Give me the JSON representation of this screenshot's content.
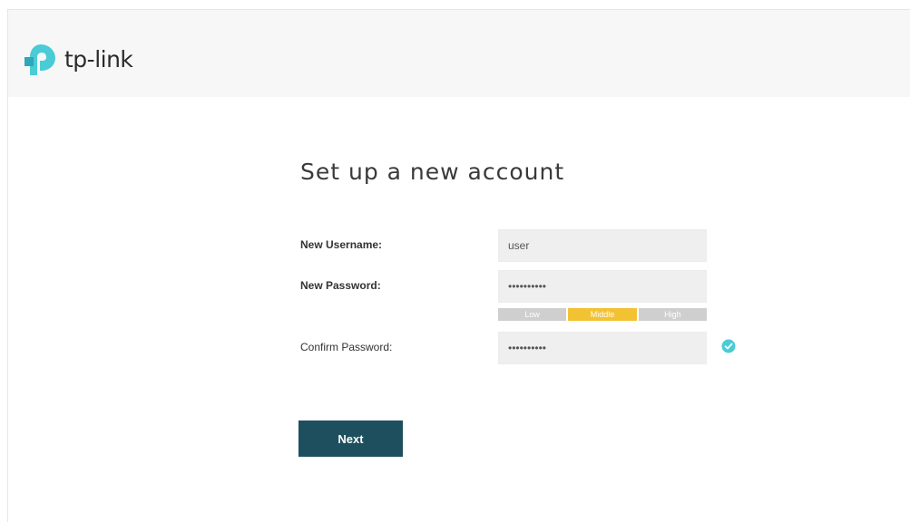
{
  "header": {
    "logo_text": "tp-link",
    "logo_colors": {
      "primary": "#4acbd6",
      "secondary": "#2ea8b9"
    }
  },
  "form": {
    "title": "Set up a new account",
    "username_label": "New Username:",
    "username_value": "user",
    "password_label": "New Password:",
    "password_value": "••••••••••",
    "strength": {
      "low_label": "Low",
      "middle_label": "Middle",
      "high_label": "High",
      "active": "middle",
      "active_color": "#f2c233",
      "inactive_color": "#cfcfcf"
    },
    "confirm_label": "Confirm Password:",
    "confirm_value": "••••••••••",
    "confirm_status_icon": "check-circle-icon",
    "next_label": "Next",
    "button_color": "#1e4f5e"
  }
}
